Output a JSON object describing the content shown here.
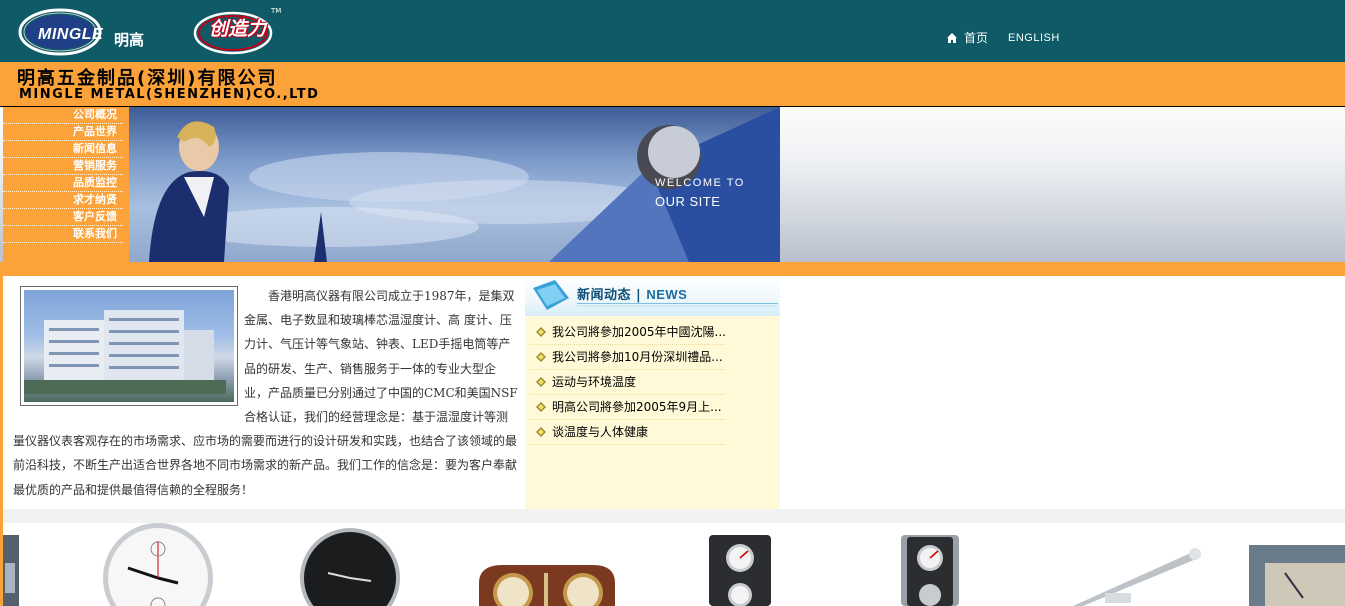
{
  "header": {
    "logo_text": "MINGLE",
    "logo_cn": "明高",
    "logo2_text": "创造力",
    "nav_home": "首页",
    "nav_english": "ENGLISH"
  },
  "company": {
    "name_cn": "明高五金制品(深圳)有限公司",
    "name_en": "MINGLE METAL(SHENZHEN)CO.,LTD"
  },
  "sidebar": {
    "items": [
      {
        "label": "公司概况"
      },
      {
        "label": "产品世界"
      },
      {
        "label": "新闻信息"
      },
      {
        "label": "营销服务"
      },
      {
        "label": "品质监控"
      },
      {
        "label": "求才纳贤"
      },
      {
        "label": "客户反馈"
      },
      {
        "label": "联系我们"
      }
    ]
  },
  "banner": {
    "welcome": "WELCOME TO",
    "oursite": "OUR SITE"
  },
  "intro": {
    "text": "香港明高仪器有限公司成立于1987年，是集双金属、电子数显和玻璃棒芯温湿度计、高 度计、压力计、气压计等气象站、钟表、LED手摇电筒等产品的研发、生产、销售服务于一体的专业大型企业，产品质量已分别通过了中国的CMC和美国NSF合格认证，我们的经营理念是：基于温湿度计等测量仪器仪表客观存在的市场需求、应市场的需要而进行的设计研发和实践，也结合了该领域的最前沿科技，不断生产出适合世界各地不同市场需求的新产品。我们工作的信念是：要为客户奉献最优质的产品和提供最值得信赖的全程服务！"
  },
  "news": {
    "title_cn": "新闻动态",
    "title_en": "NEWS",
    "items": [
      {
        "label": "我公司將參加2005年中國沈陽..."
      },
      {
        "label": "我公司將參加10月份深圳禮品..."
      },
      {
        "label": "运动与环境温度"
      },
      {
        "label": "明高公司將參加2005年9月上..."
      },
      {
        "label": "谈温度与人体健康"
      }
    ]
  },
  "colors": {
    "teal": "#0e5a66",
    "orange": "#fca23a",
    "news_bg": "#fff9d8"
  }
}
